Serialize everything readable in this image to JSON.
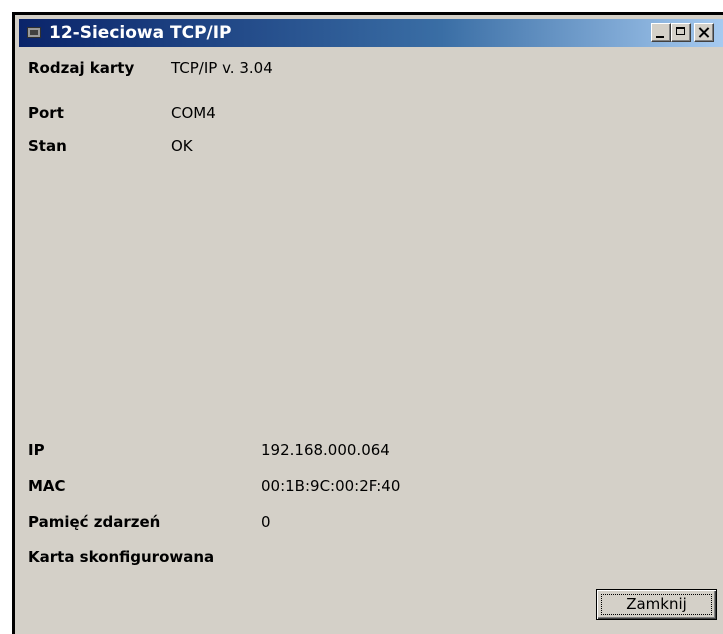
{
  "window": {
    "title": "12-Sieciowa TCP/IP"
  },
  "info_top": [
    {
      "label": "Rodzaj karty",
      "value": "TCP/IP v. 3.04"
    },
    {
      "label": "Port",
      "value": "COM4"
    },
    {
      "label": "Stan",
      "value": "OK"
    }
  ],
  "info_bottom": [
    {
      "label": "IP",
      "value": "192.168.000.064"
    },
    {
      "label": "MAC",
      "value": "00:1B:9C:00:2F:40"
    },
    {
      "label": "Pamięć zdarzeń",
      "value": "0"
    },
    {
      "label": "Karta skonfigurowana",
      "value": ""
    }
  ],
  "buttons": {
    "close_label": "Zamknij"
  },
  "colors": {
    "titlebar_start": "#0a246a",
    "titlebar_end": "#a6caf0",
    "window_bg": "#d4d0c8"
  }
}
